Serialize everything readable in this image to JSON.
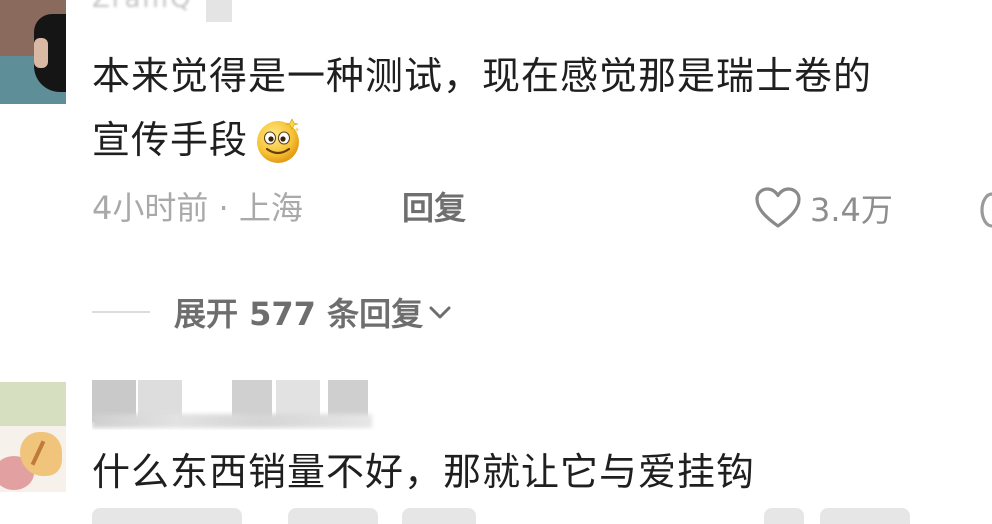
{
  "comments": [
    {
      "username": "ZraniQ",
      "text_line1": "本来觉得是一种测试，现在感觉那是瑞士卷的",
      "text_line2": "宣传手段",
      "emoji_icon": "dizzy-smile-emoji-icon",
      "time": "4小时前",
      "separator": " · ",
      "location": "上海",
      "reply_label": "回复",
      "like_count": "3.4万"
    },
    {
      "text_line1": "什么东西销量不好，那就让它与爱挂钩"
    }
  ],
  "expand_replies": {
    "label": "展开 577 条回复"
  },
  "icons": {
    "like": "heart-outline-icon",
    "dislike": "dislike-icon",
    "expand": "chevron-down-icon"
  },
  "colors": {
    "text_primary": "#1f1f1f",
    "text_meta": "#a9a9a9",
    "text_action": "#6f6f6f",
    "background": "#ffffff"
  }
}
